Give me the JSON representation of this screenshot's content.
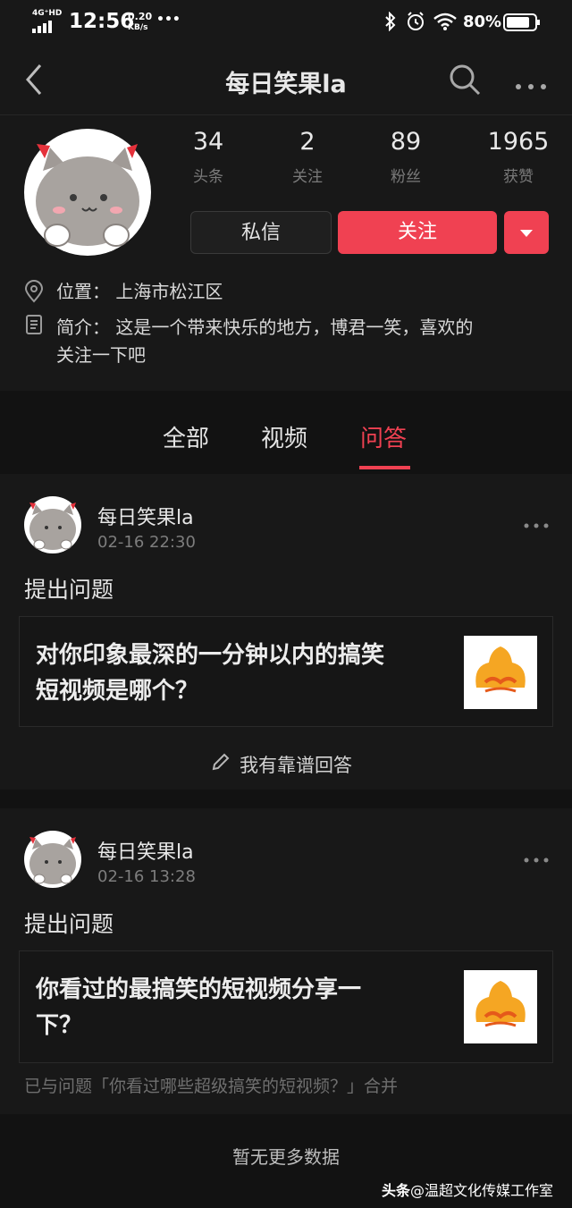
{
  "status_bar": {
    "network": "4G⁺HD",
    "time": "12:56",
    "speed_value": "0.20",
    "speed_unit": "KB/s",
    "dots": "•••",
    "battery": "80%"
  },
  "nav": {
    "title": "每日笑果la"
  },
  "profile": {
    "stats": [
      {
        "value": "34",
        "label": "头条"
      },
      {
        "value": "2",
        "label": "关注"
      },
      {
        "value": "89",
        "label": "粉丝"
      },
      {
        "value": "1965",
        "label": "获赞"
      }
    ],
    "message_label": "私信",
    "follow_label": "关注",
    "location": "位置： 上海市松江区",
    "intro_line1": "简介： 这是一个带来快乐的地方，博君一笑，喜欢的",
    "intro_line2": "关注一下吧"
  },
  "tabs": {
    "items": [
      {
        "label": "全部"
      },
      {
        "label": "视频"
      },
      {
        "label": "问答"
      }
    ],
    "active": "问答"
  },
  "posts": [
    {
      "author": "每日笑果la",
      "time": "02-16 22:30",
      "kind": "提出问题",
      "question_line1": "对你印象最深的一分钟以内的搞笑",
      "question_line2": "短视频是哪个？",
      "answer_label": "我有靠谱回答"
    },
    {
      "author": "每日笑果la",
      "time": "02-16 13:28",
      "kind": "提出问题",
      "question_line1": "你看过的最搞笑的短视频分享一",
      "question_line2": "下？",
      "merged_note": "已与问题「你看过哪些超级搞笑的短视频？」合并"
    }
  ],
  "footer": {
    "no_more": "暂无更多数据",
    "credit_brand": "头条",
    "credit_text": "@温超文化传媒工作室"
  },
  "colors": {
    "accent": "#f04152",
    "background": "#121212",
    "surface": "#181818"
  }
}
